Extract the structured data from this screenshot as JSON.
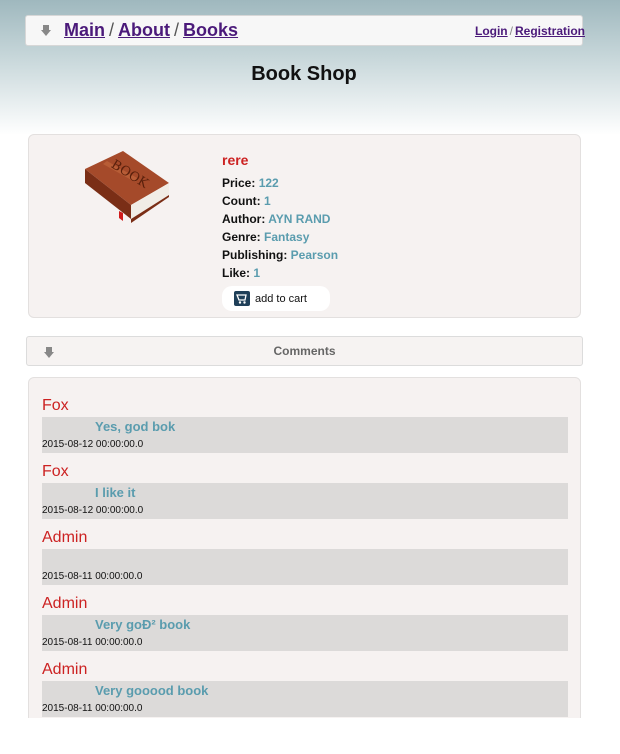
{
  "nav": {
    "breadcrumbs": [
      "Main",
      "About",
      "Books"
    ],
    "separator": "/",
    "login": "Login",
    "auth_separator": "/",
    "registration": "Registration"
  },
  "page_title": "Book Shop",
  "book": {
    "title": "rere",
    "price_label": "Price:",
    "price": "122",
    "count_label": "Count:",
    "count": "1",
    "author_label": "Author:",
    "author": "AYN RAND",
    "genre_label": "Genre:",
    "genre": "Fantasy",
    "publishing_label": "Publishing:",
    "publishing": "Pearson",
    "like_label": "Like:",
    "like": "1",
    "cart_label": "add to cart",
    "image_text": "BOOK"
  },
  "comments_header": "Comments",
  "comments": [
    {
      "author": "Fox",
      "text": "Yes, god bok",
      "date": "2015-08-12 00:00:00.0"
    },
    {
      "author": "Fox",
      "text": "I like it",
      "date": "2015-08-12 00:00:00.0"
    },
    {
      "author": "Admin",
      "text": "",
      "date": "2015-08-11 00:00:00.0"
    },
    {
      "author": "Admin",
      "text": "Very goÐ² book",
      "date": "2015-08-11 00:00:00.0"
    },
    {
      "author": "Admin",
      "text": "Very gooood book",
      "date": "2015-08-11 00:00:00.0"
    }
  ],
  "colors": {
    "accent_red": "#cc2222",
    "value_blue": "#5a9cae",
    "link_purple": "#4b1a7a"
  }
}
